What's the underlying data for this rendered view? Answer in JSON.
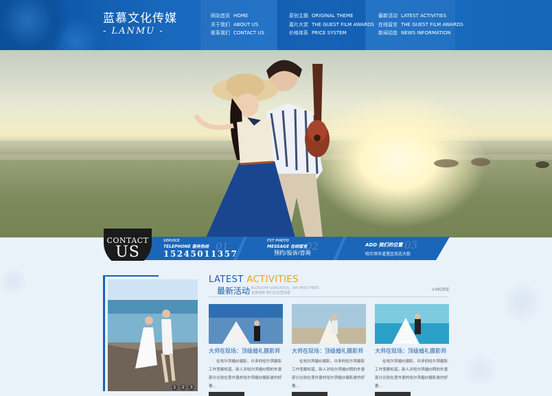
{
  "logo": {
    "cn": "蓝慕文化传媒",
    "en": "- LANMU -"
  },
  "nav": [
    [
      {
        "zh": "网站首页",
        "en": "HOME"
      },
      {
        "zh": "关于我们",
        "en": "ABOUT US"
      },
      {
        "zh": "联系我们",
        "en": "CONTACT US"
      }
    ],
    [
      {
        "zh": "原创主题",
        "en": "ORIGINAL THEME"
      },
      {
        "zh": "嘉片大赏",
        "en": "THE GUEST FILM AWARDS"
      },
      {
        "zh": "价格体系",
        "en": "PRICE SYSTEM"
      }
    ],
    [
      {
        "zh": "最新活动",
        "en": "LATEST ACTIVITIES"
      },
      {
        "zh": "在线留言",
        "en": "THE GUEST FILM AWARDS"
      },
      {
        "zh": "新闻动态",
        "en": "NEWS INFORMATION"
      }
    ]
  ],
  "contact": {
    "circle_top": "CONTACT",
    "circle_big": "US",
    "cells": [
      {
        "lab1": "SERVICE",
        "lab2": "TELEPHONE 服务热线",
        "num": "01",
        "value": "15245011357"
      },
      {
        "lab1": "FST PHOTO",
        "lab2": "MESSAGE 在线留言",
        "num": "02",
        "value": "预约/投诉/咨询"
      },
      {
        "lab1": "",
        "lab2": "ADD 我们的位置",
        "num": "03",
        "value": "哈尔滨市道里区尚志大街"
      }
    ]
  },
  "latest": {
    "title_a": "LATEST ",
    "title_b": "ACTIVITIES",
    "title_zh": "最新活动",
    "sub1": "BLOSSOM GORGEOUS , WE MEET HERE",
    "sub2": "蓝慕绚丽 我们在这里相遇",
    "more": "+MORE",
    "cards": [
      {
        "title": "大师在现场：顶级婚礼摄影师",
        "desc": "在哈尔滨婚纱摄影，许多的哈尔滨摄影工作室都知道，新人对哈尔滨婚纱照的外景部分比较在意外景的哈尔滨婚纱摄影是的好看..."
      },
      {
        "title": "大师在现场：顶级婚礼摄影师",
        "desc": "在哈尔滨婚纱摄影，许多的哈尔滨摄影工作室都知道，新人对哈尔滨婚纱照的外景部分比较在意外景的哈尔滨婚纱摄影是的好看..."
      },
      {
        "title": "大师在现场：顶级婚礼摄影师",
        "desc": "在哈尔滨婚纱摄影，许多的哈尔滨摄影工作室都知道，新人对哈尔滨婚纱照的外景部分比较在意外景的哈尔滨婚纱摄影是的好看..."
      }
    ]
  },
  "slider_dots": [
    "1",
    "2",
    "3"
  ],
  "colors": {
    "brand": "#1762b4",
    "accent": "#f29d18",
    "dark": "#1b1b1b"
  }
}
